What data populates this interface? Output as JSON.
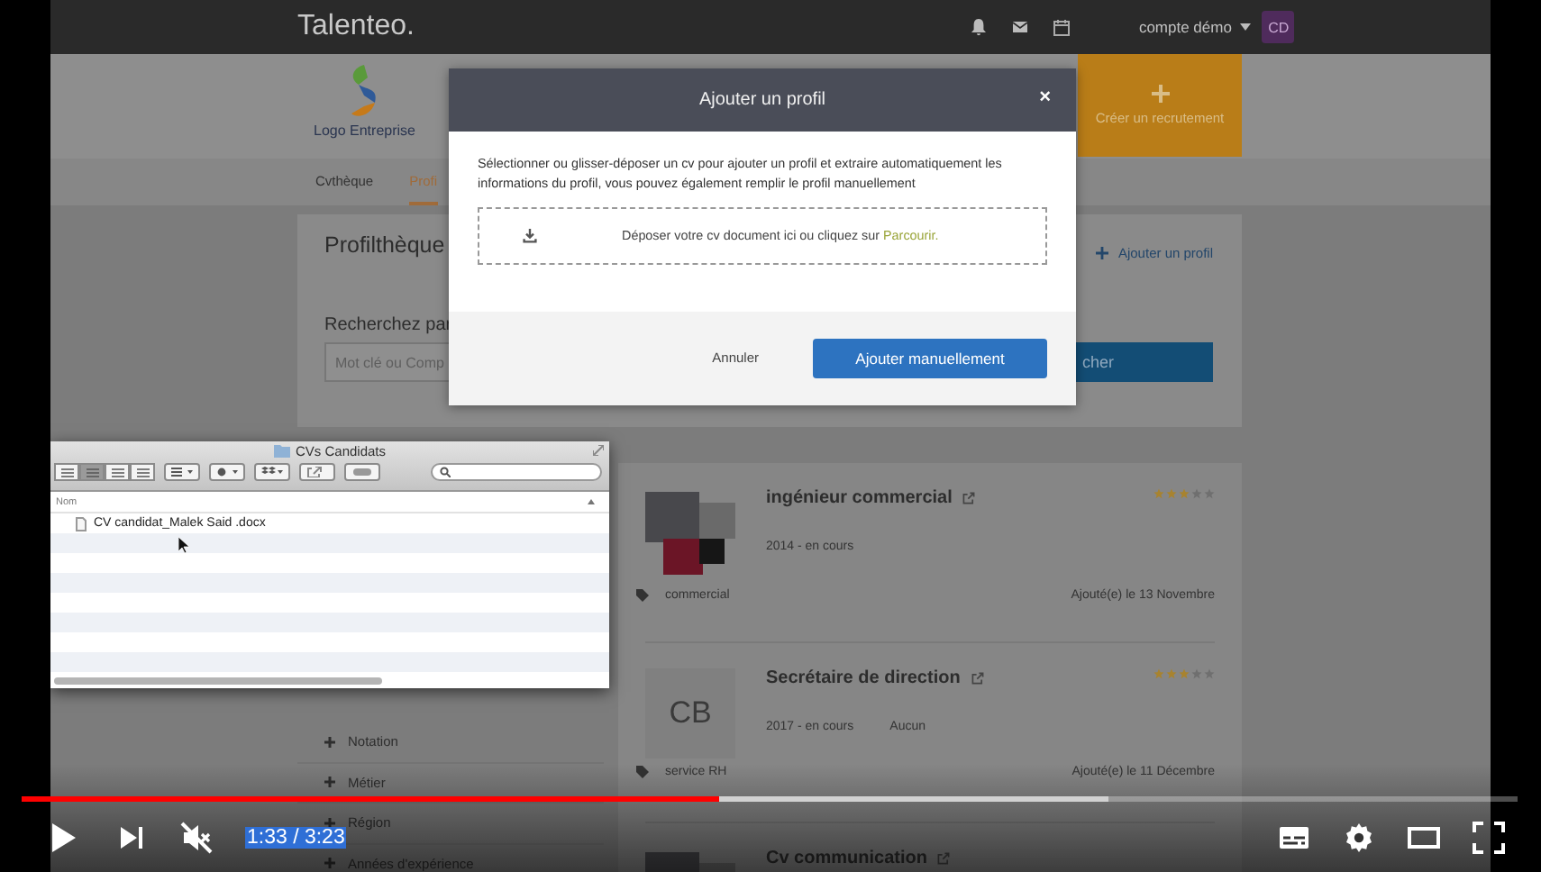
{
  "player": {
    "time": "1:33 / 3:23",
    "muted": true,
    "progress": {
      "level": 0.466
    },
    "buffered": {
      "level": 0.727
    }
  },
  "nav": {
    "brand": "Talenteo.",
    "account": "compte démo",
    "avatar": "CD"
  },
  "header": {
    "logo_label": "Logo Entreprise",
    "create_button": "Créer un recrutement"
  },
  "tabs": [
    {
      "label": "Cvthèque",
      "selected": false
    },
    {
      "label": "Profi",
      "selected": true
    }
  ],
  "profiles_panel": {
    "title": "Profilthèque",
    "add_link": "Ajouter un profil",
    "search_label": "Recherchez par",
    "search_placeholder": "Mot clé ou Comp",
    "search_button": "cher"
  },
  "filters": [
    "Notation",
    "Métier",
    "Région",
    "Années d'expérience"
  ],
  "profiles": [
    {
      "kind": "photo",
      "title": "ingénieur commercial",
      "period": "2014 - en cours",
      "tag": "commercial",
      "added": "Ajouté(e) le 13 Novembre",
      "stars": 3
    },
    {
      "kind": "initials",
      "initials": "CB",
      "title": "Secrétaire de direction",
      "period": "2017 - en cours",
      "company": "Aucun",
      "tag": "service RH",
      "added": "Ajouté(e) le 11 Décembre",
      "stars": 3
    },
    {
      "kind": "photo",
      "title": "Cv communication"
    }
  ],
  "modal": {
    "title": "Ajouter un profil",
    "close": "×",
    "description": "Sélectionner ou glisser-déposer un cv pour ajouter un profil et extraire automatiquement les informations du profil, vous pouvez également remplir le profil manuellement",
    "dropzone_text": "Déposer votre cv document ici ou cliquez sur ",
    "dropzone_link": "Parcourir.",
    "cancel": "Annuler",
    "confirm": "Ajouter manuellement"
  },
  "finder": {
    "title": "CVs Candidats",
    "view_modes": [
      {
        "selected": false
      },
      {
        "selected": true
      },
      {
        "selected": false
      },
      {
        "selected": false
      }
    ],
    "column": "Nom",
    "files": [
      "CV candidat_Malek Said .docx"
    ]
  }
}
